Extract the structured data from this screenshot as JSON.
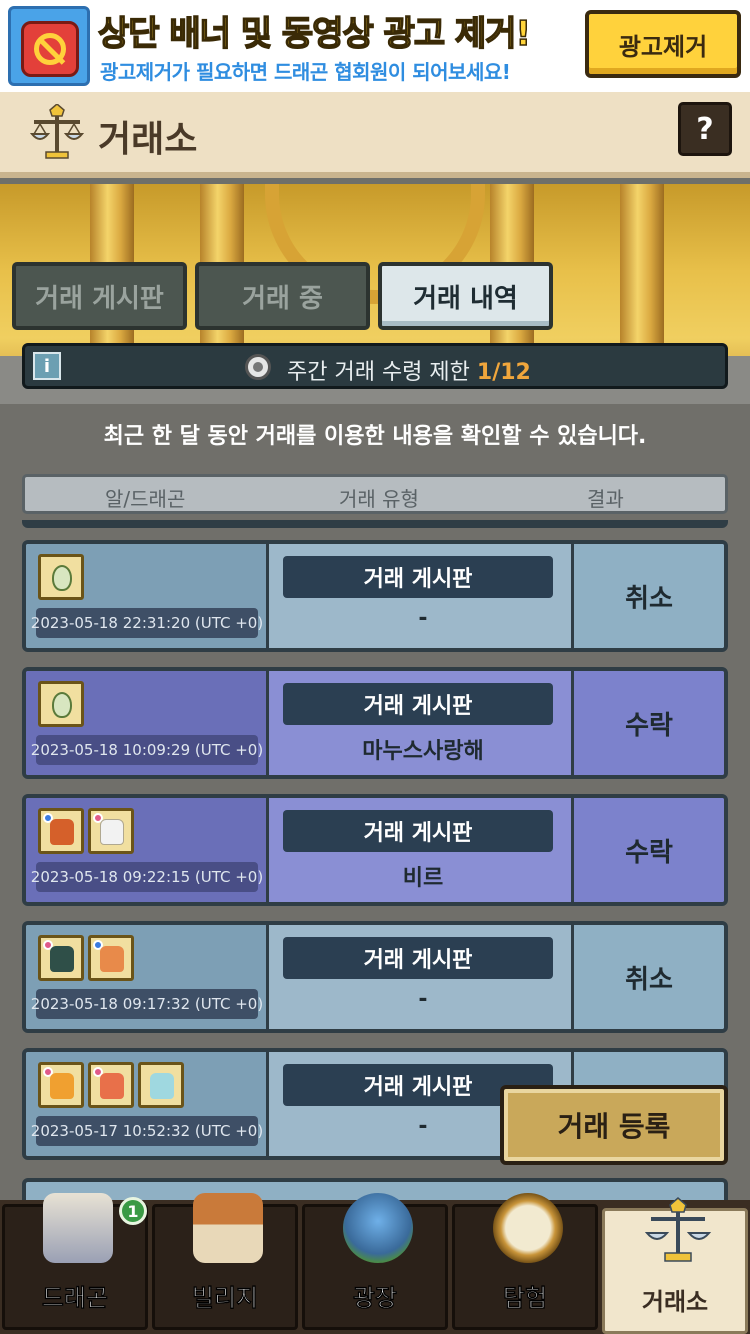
{
  "ad": {
    "title": "상단 배너 및 동영상 광고 제거!",
    "subtitle": "광고제거가 필요하면 드래곤 협회원이 되어보세요!",
    "button": "광고제거"
  },
  "header": {
    "title": "거래소",
    "help": "?"
  },
  "tabs": [
    {
      "label": "거래 게시판",
      "active": false
    },
    {
      "label": "거래 중",
      "active": false
    },
    {
      "label": "거래 내역",
      "active": true
    }
  ],
  "limit": {
    "label": "주간 거래 수령 제한",
    "count": "1/12"
  },
  "notice": "최근 한 달 동안 거래를 이용한 내용을 확인할 수 있습니다.",
  "columns": {
    "item": "알/드래곤",
    "type": "거래 유형",
    "result": "결과"
  },
  "rows": [
    {
      "date": "2023-05-18 22:31:20 (UTC +0)",
      "type": "거래 게시판",
      "partner": "-",
      "result": "취소"
    },
    {
      "date": "2023-05-18 10:09:29 (UTC +0)",
      "type": "거래 게시판",
      "partner": "마누스사랑해",
      "result": "수락"
    },
    {
      "date": "2023-05-18 09:22:15 (UTC +0)",
      "type": "거래 게시판",
      "partner": "비르",
      "result": "수락"
    },
    {
      "date": "2023-05-18 09:17:32 (UTC +0)",
      "type": "거래 게시판",
      "partner": "-",
      "result": "취소"
    },
    {
      "date": "2023-05-17 10:52:32 (UTC +0)",
      "type": "거래 게시판",
      "partner": "-",
      "result": ""
    }
  ],
  "register_button": "거래 등록",
  "nav": {
    "items": [
      {
        "label": "드래곤",
        "badge": "1"
      },
      {
        "label": "빌리지"
      },
      {
        "label": "광장"
      },
      {
        "label": "탐험"
      },
      {
        "label": "거래소",
        "active": true
      }
    ]
  }
}
